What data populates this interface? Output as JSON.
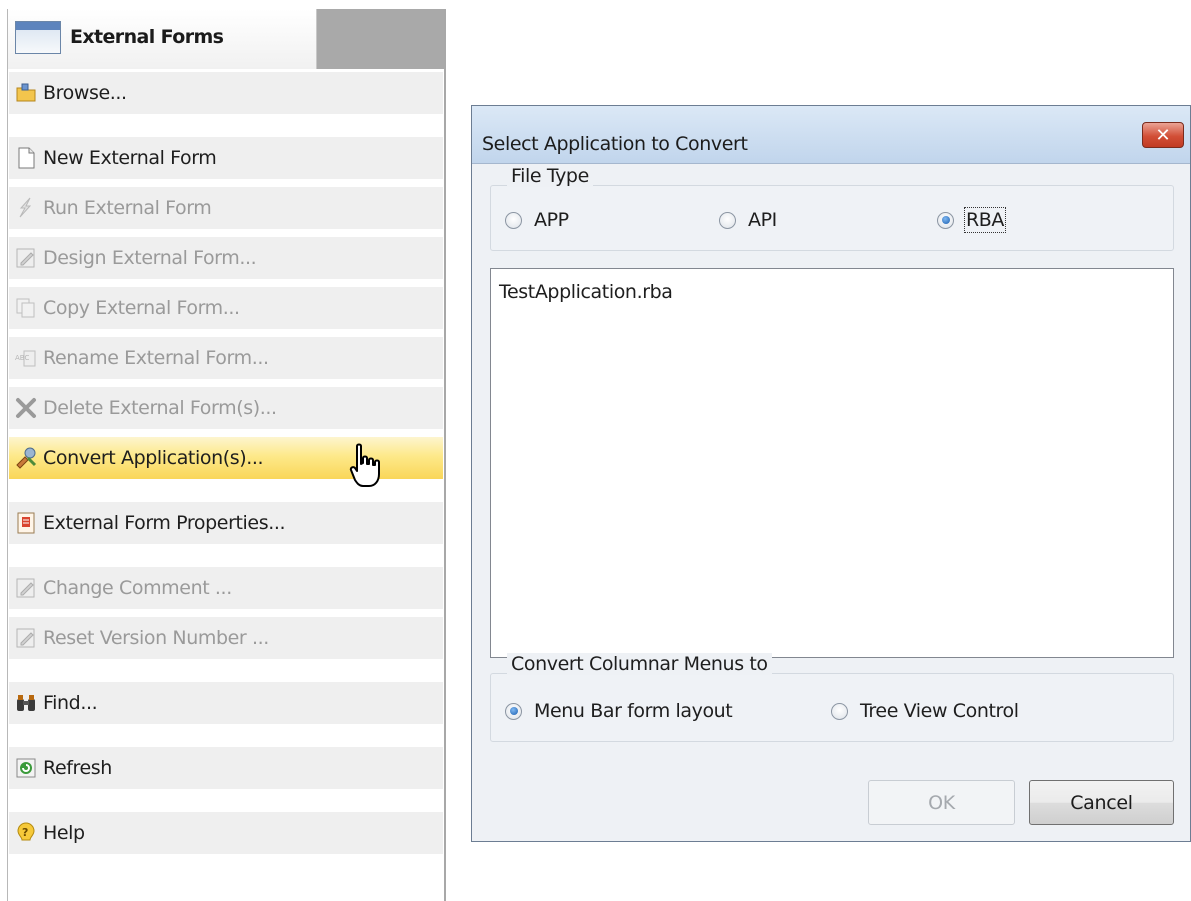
{
  "panel": {
    "tab_title": "External Forms",
    "items": [
      {
        "label": "Browse...",
        "icon": "browse-icon",
        "enabled": true
      },
      {
        "label": "New External Form",
        "icon": "new-document-icon",
        "enabled": true
      },
      {
        "label": "Run External Form",
        "icon": "run-icon",
        "enabled": false
      },
      {
        "label": "Design External Form...",
        "icon": "design-icon",
        "enabled": false
      },
      {
        "label": "Copy External Form...",
        "icon": "copy-icon",
        "enabled": false
      },
      {
        "label": "Rename External Form...",
        "icon": "rename-icon",
        "enabled": false
      },
      {
        "label": "Delete External Form(s)...",
        "icon": "delete-icon",
        "enabled": false
      },
      {
        "label": "Convert Application(s)...",
        "icon": "convert-icon",
        "enabled": true,
        "highlighted": true
      },
      {
        "label": "External Form Properties...",
        "icon": "properties-icon",
        "enabled": true
      },
      {
        "label": "Change Comment ...",
        "icon": "comment-icon",
        "enabled": false
      },
      {
        "label": "Reset Version Number ...",
        "icon": "reset-version-icon",
        "enabled": false
      },
      {
        "label": "Find...",
        "icon": "binoculars-icon",
        "enabled": true
      },
      {
        "label": "Refresh",
        "icon": "refresh-icon",
        "enabled": true
      },
      {
        "label": "Help",
        "icon": "help-icon",
        "enabled": true
      }
    ]
  },
  "dialog": {
    "title": "Select Application to Convert",
    "close_label": "✕",
    "file_type": {
      "legend": "File Type",
      "options": [
        {
          "label": "APP",
          "selected": false
        },
        {
          "label": "API",
          "selected": false
        },
        {
          "label": "RBA",
          "selected": true
        }
      ]
    },
    "list": {
      "items": [
        "TestApplication.rba"
      ]
    },
    "convert_menus": {
      "legend": "Convert Columnar Menus to",
      "options": [
        {
          "label": "Menu Bar form layout",
          "selected": true
        },
        {
          "label": "Tree View Control",
          "selected": false
        }
      ]
    },
    "ok_label": "OK",
    "ok_enabled": false,
    "cancel_label": "Cancel"
  },
  "colors": {
    "hover_highlight": "#fde98a",
    "disabled_text": "#9a9a9a",
    "dialog_background": "#eef1f5",
    "close_button": "#d24f37"
  }
}
